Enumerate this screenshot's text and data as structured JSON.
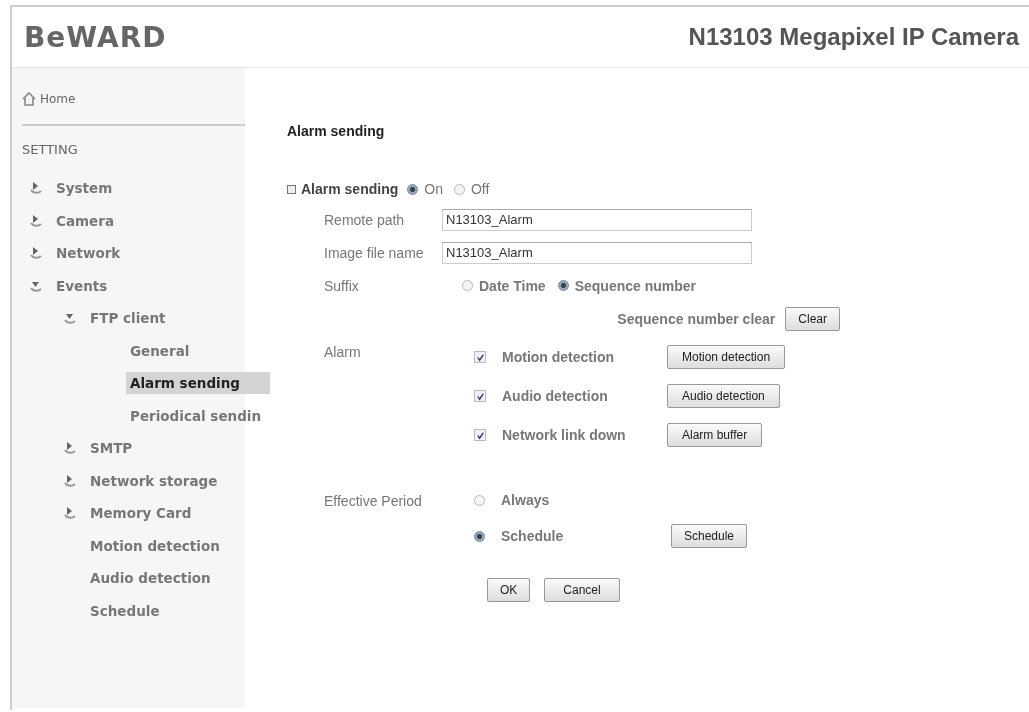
{
  "header": {
    "logo": "BeWARD",
    "title": "N13103 Megapixel IP Camera"
  },
  "sidebar": {
    "home": "Home",
    "section": "SETTING",
    "items": [
      {
        "label": "System",
        "expanded": false,
        "selected": false
      },
      {
        "label": "Camera",
        "expanded": false,
        "selected": false
      },
      {
        "label": "Network",
        "expanded": false,
        "selected": false
      },
      {
        "label": "Events",
        "expanded": true,
        "selected": false,
        "children": [
          {
            "label": "FTP client",
            "expanded": true,
            "selected": false,
            "children": [
              {
                "label": "General",
                "selected": false
              },
              {
                "label": "Alarm sending",
                "selected": true
              },
              {
                "label": "Periodical sendin",
                "selected": false
              }
            ]
          },
          {
            "label": "SMTP",
            "expanded": false,
            "selected": false
          },
          {
            "label": "Network storage",
            "expanded": false,
            "selected": false
          },
          {
            "label": "Memory Card",
            "expanded": false,
            "selected": false
          },
          {
            "label": "Motion detection",
            "selected": false
          },
          {
            "label": "Audio detection",
            "selected": false
          },
          {
            "label": "Schedule",
            "selected": false
          }
        ]
      }
    ]
  },
  "content": {
    "title": "Alarm sending",
    "enable": {
      "label": "Alarm sending",
      "options": [
        {
          "label": "On",
          "selected": true
        },
        {
          "label": "Off",
          "selected": false
        }
      ]
    },
    "remote_path": {
      "label": "Remote path",
      "value": "N13103_Alarm"
    },
    "image_file_name": {
      "label": "Image file name",
      "value": "N13103_Alarm"
    },
    "suffix": {
      "label": "Suffix",
      "options": [
        {
          "label": "Date Time",
          "selected": false
        },
        {
          "label": "Sequence number",
          "selected": true
        }
      ]
    },
    "sequence_clear": {
      "label": "Sequence number clear",
      "button": "Clear"
    },
    "alarm": {
      "label": "Alarm",
      "items": [
        {
          "label": "Motion detection",
          "checked": true,
          "button": "Motion detection"
        },
        {
          "label": "Audio detection",
          "checked": true,
          "button": "Audio detection"
        },
        {
          "label": "Network link down",
          "checked": true,
          "button": "Alarm buffer"
        }
      ]
    },
    "effective_period": {
      "label": "Effective Period",
      "options": [
        {
          "label": "Always",
          "selected": false
        },
        {
          "label": "Schedule",
          "selected": true,
          "button": "Schedule"
        }
      ]
    },
    "buttons": [
      "OK",
      "Cancel"
    ]
  }
}
